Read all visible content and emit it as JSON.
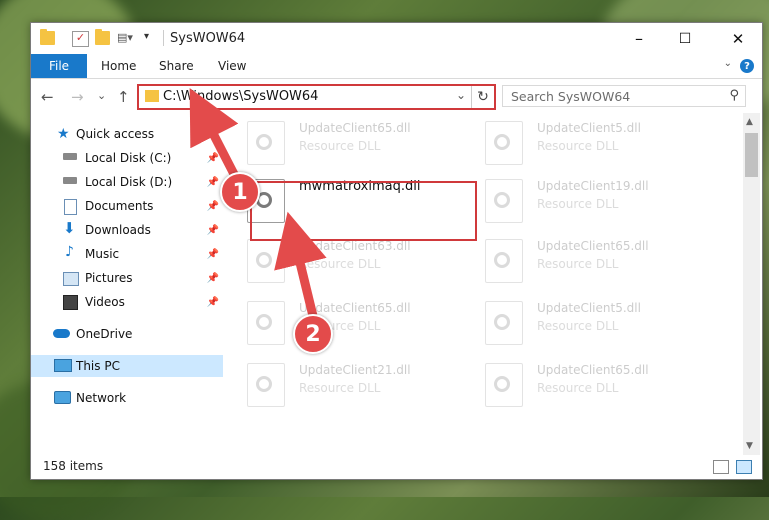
{
  "window": {
    "title": "SysWOW64",
    "minimize_label": "–",
    "maximize_label": "☐",
    "close_label": "✕"
  },
  "ribbon": {
    "tabs": [
      "File",
      "Home",
      "Share",
      "View"
    ],
    "help_label": "?"
  },
  "nav": {
    "back_label": "←",
    "forward_label": "→",
    "recent_label": "⌄",
    "up_label": "↑",
    "address": "C:\\Windows\\SysWOW64",
    "refresh_label": "↻",
    "search_placeholder": "Search SysWOW64"
  },
  "sidebar": {
    "items": [
      {
        "label": "Quick access",
        "icon": "star-icon",
        "pinned": false
      },
      {
        "label": "Local Disk (C:)",
        "icon": "disk-icon",
        "pinned": true
      },
      {
        "label": "Local Disk (D:)",
        "icon": "disk-icon",
        "pinned": true
      },
      {
        "label": "Documents",
        "icon": "documents-icon",
        "pinned": true
      },
      {
        "label": "Downloads",
        "icon": "download-icon",
        "pinned": true
      },
      {
        "label": "Music",
        "icon": "music-icon",
        "pinned": true
      },
      {
        "label": "Pictures",
        "icon": "pictures-icon",
        "pinned": true
      },
      {
        "label": "Videos",
        "icon": "videos-icon",
        "pinned": true
      },
      {
        "label": "OneDrive",
        "icon": "cloud-icon",
        "pinned": false
      },
      {
        "label": "This PC",
        "icon": "computer-icon",
        "pinned": false,
        "selected": true
      },
      {
        "label": "Network",
        "icon": "network-icon",
        "pinned": false
      }
    ]
  },
  "files": [
    {
      "name": "UpdateClient65.dll",
      "type": "Resource DLL"
    },
    {
      "name": "UpdateClient5.dll",
      "type": "Resource DLL"
    },
    {
      "name": "mwmatroximaq.dll",
      "type": "",
      "highlighted": true
    },
    {
      "name": "UpdateClient19.dll",
      "type": "Resource DLL"
    },
    {
      "name": "UpdateClient63.dll",
      "type": "Resource DLL"
    },
    {
      "name": "UpdateClient65.dll",
      "type": "Resource DLL"
    },
    {
      "name": "UpdateClient65.dll",
      "type": "Resource DLL"
    },
    {
      "name": "UpdateClient5.dll",
      "type": "Resource DLL"
    },
    {
      "name": "UpdateClient21.dll",
      "type": "Resource DLL"
    },
    {
      "name": "UpdateClient65.dll",
      "type": "Resource DLL"
    }
  ],
  "status": {
    "item_count": "158 items"
  },
  "annotations": {
    "step1": "1",
    "step2": "2",
    "color": "#e34b4b"
  },
  "colors": {
    "accent": "#1979ca",
    "highlight_border": "#d0393b",
    "selected_bg": "#cce8ff"
  }
}
